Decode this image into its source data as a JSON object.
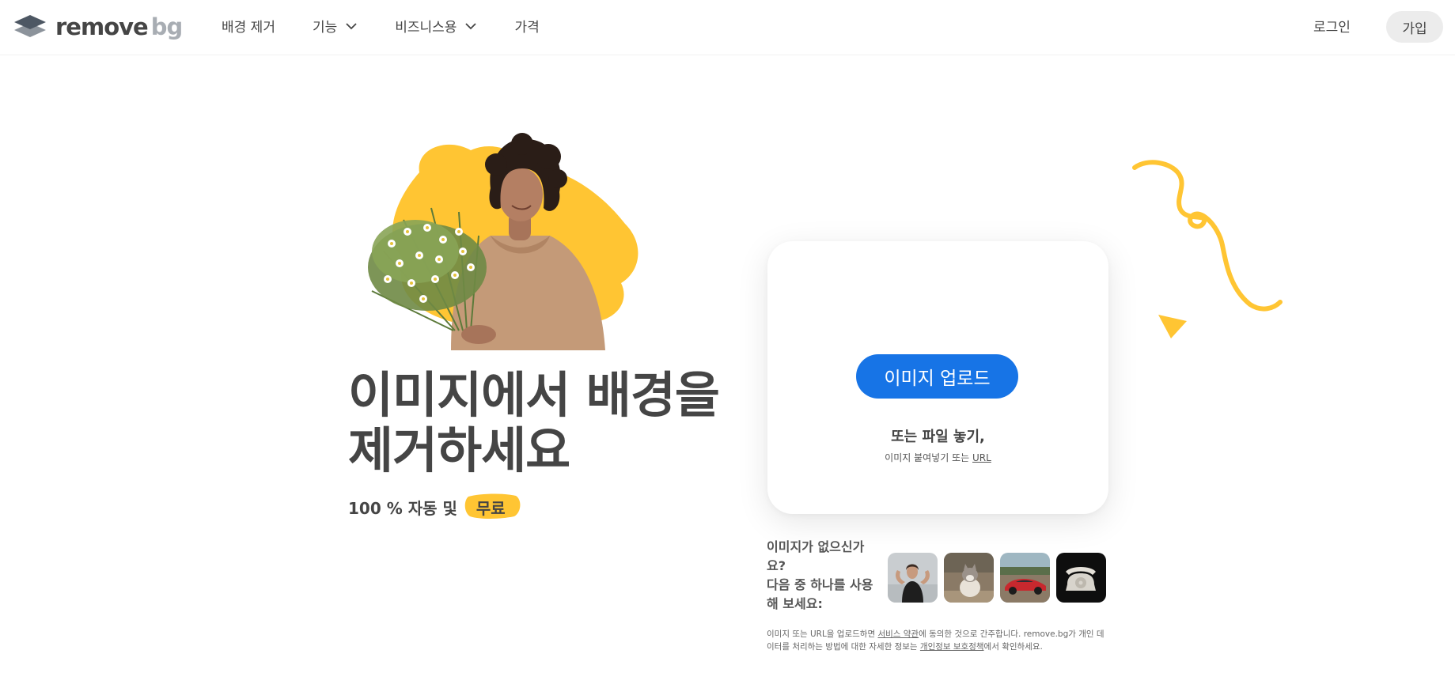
{
  "header": {
    "logo_main": "remove",
    "logo_suffix": "bg",
    "nav": [
      {
        "label": "배경 제거",
        "has_dropdown": false
      },
      {
        "label": "기능",
        "has_dropdown": true
      },
      {
        "label": "비즈니스용",
        "has_dropdown": true
      },
      {
        "label": "가격",
        "has_dropdown": false
      }
    ],
    "login_label": "로그인",
    "signup_label": "가입"
  },
  "hero": {
    "headline_line1": "이미지에서 배경을",
    "headline_line2": "제거하세요",
    "subline_prefix": "100 % 자동 및",
    "subline_badge": "무료"
  },
  "upload": {
    "button_label": "이미지 업로드",
    "drop_title": "또는 파일 놓기,",
    "drop_sub_prefix": "이미지 붙여넣기 또는",
    "drop_sub_link": "URL"
  },
  "samples": {
    "label_line1": "이미지가 없으신가",
    "label_line2": "요?",
    "label_line3": "다음 중 하나를 사용",
    "label_line4": "해 보세요:",
    "items": [
      "sample-woman-icon",
      "sample-cat-icon",
      "sample-car-icon",
      "sample-telephone-icon"
    ]
  },
  "legal": {
    "part1": "이미지 또는 URL을 업로드하면 ",
    "terms_link": "서비스 약관",
    "part2": "에 동의한 것으로 간주합니다. remove.bg가 개인 데이터를 처리하는 방법에 대한 자세한 정보는 ",
    "privacy_link": "개인정보 보호정책",
    "part3": "에서 확인하세요."
  },
  "colors": {
    "brand_blue": "#1774e6",
    "accent_yellow": "#ffc533",
    "text_dark": "#454545"
  }
}
